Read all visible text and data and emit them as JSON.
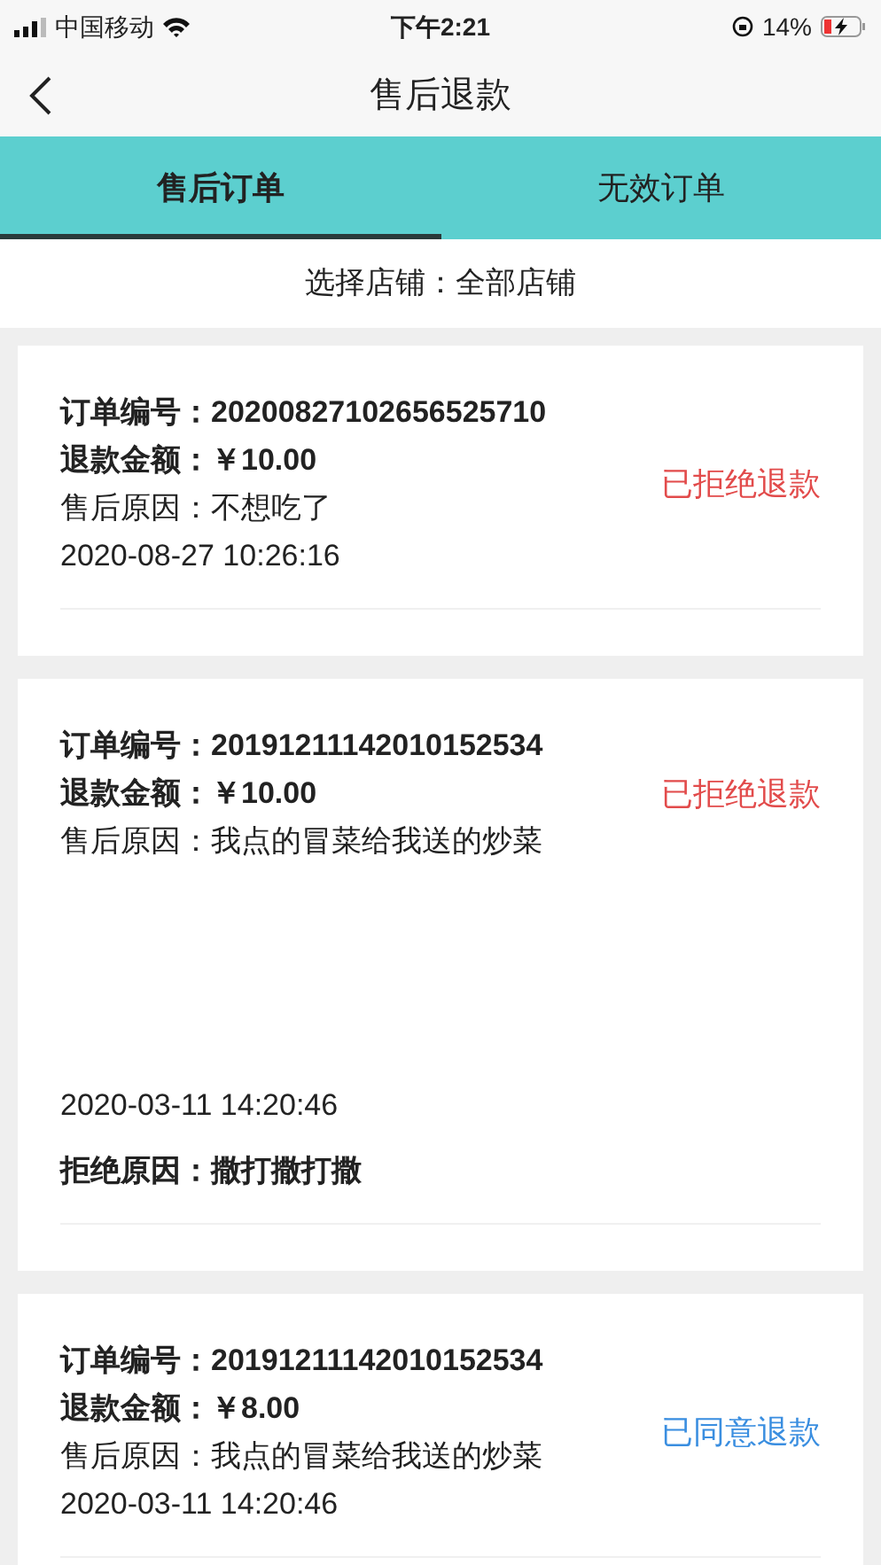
{
  "status_bar": {
    "carrier": "中国移动",
    "time": "下午2:21",
    "battery": "14%"
  },
  "nav": {
    "title": "售后退款"
  },
  "tabs": [
    {
      "label": "售后订单",
      "selected": true
    },
    {
      "label": "无效订单",
      "selected": false
    }
  ],
  "store_filter": {
    "label": "选择店铺：",
    "value": "全部店铺"
  },
  "orders": [
    {
      "order_no_label": "订单编号：",
      "order_no": "20200827102656525710",
      "amount_label": "退款金额：",
      "amount": "￥10.00",
      "reason_label": "售后原因：",
      "reason": "不想吃了",
      "time": "2020-08-27 10:26:16",
      "status": {
        "text": "已拒绝退款",
        "color": "#e24b4b"
      }
    },
    {
      "order_no_label": "订单编号：",
      "order_no": "20191211142010152534",
      "amount_label": "退款金额：",
      "amount": "￥10.00",
      "reason_label": "售后原因：",
      "reason": "我点的冒菜给我送的炒菜",
      "time": "2020-03-11 14:20:46",
      "status": {
        "text": "已拒绝退款",
        "color": "#e24b4b"
      },
      "reject_label": "拒绝原因：",
      "reject_reason": "撒打撒打撒"
    },
    {
      "order_no_label": "订单编号：",
      "order_no": "20191211142010152534",
      "amount_label": "退款金额：",
      "amount": "￥8.00",
      "reason_label": "售后原因：",
      "reason": "我点的冒菜给我送的炒菜",
      "time": "2020-03-11 14:20:46",
      "status": {
        "text": "已同意退款",
        "color": "#3a8ee0"
      }
    }
  ]
}
